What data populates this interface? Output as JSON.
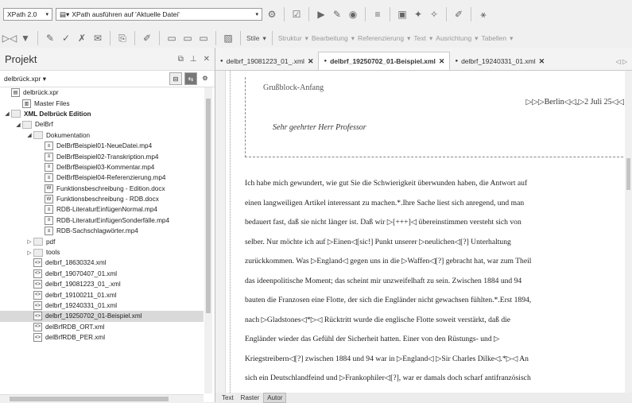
{
  "toolbar": {
    "xpath_version": "XPath 2.0",
    "xpath_scope": "XPath ausführen auf 'Aktuelle Datei'",
    "menus": [
      "Stile",
      "Struktur",
      "Bearbeitung",
      "Referenzierung",
      "Text",
      "Ausrichtung",
      "Tabellen"
    ]
  },
  "project": {
    "title": "Projekt",
    "file": "delbrück.xpr",
    "tree": [
      {
        "label": "delbrück.xpr",
        "depth": 0,
        "twisty": "",
        "icon": "project"
      },
      {
        "label": "Master Files",
        "depth": 1,
        "twisty": "",
        "icon": "master"
      },
      {
        "label": "XML Delbrück Edition",
        "depth": 0,
        "twisty": "◢",
        "icon": "folder",
        "bold": true
      },
      {
        "label": "DelBrf",
        "depth": 1,
        "twisty": "◢",
        "icon": "folder"
      },
      {
        "label": "Dokumentation",
        "depth": 2,
        "twisty": "◢",
        "icon": "folder"
      },
      {
        "label": "DelBrfBeispiel01-NeueDatei.mp4",
        "depth": 3,
        "twisty": "",
        "icon": "file"
      },
      {
        "label": "DelBrfBeispiel02-Transkription.mp4",
        "depth": 3,
        "twisty": "",
        "icon": "file"
      },
      {
        "label": "DelBrfBeispiel03-Kommentar.mp4",
        "depth": 3,
        "twisty": "",
        "icon": "file"
      },
      {
        "label": "DelBrfBeispiel04-Referenzierung.mp4",
        "depth": 3,
        "twisty": "",
        "icon": "file"
      },
      {
        "label": "Funktionsbeschreibung - Edition.docx",
        "depth": 3,
        "twisty": "",
        "icon": "docx"
      },
      {
        "label": "Funktionsbeschreibung - RDB.docx",
        "depth": 3,
        "twisty": "",
        "icon": "docx"
      },
      {
        "label": "RDB-LiteraturEinfügenNormal.mp4",
        "depth": 3,
        "twisty": "",
        "icon": "file"
      },
      {
        "label": "RDB-LiteraturEinfügenSonderfälle.mp4",
        "depth": 3,
        "twisty": "",
        "icon": "file"
      },
      {
        "label": "RDB-Sachschlagwörter.mp4",
        "depth": 3,
        "twisty": "",
        "icon": "file"
      },
      {
        "label": "pdf",
        "depth": 2,
        "twisty": "▷",
        "icon": "folder"
      },
      {
        "label": "tools",
        "depth": 2,
        "twisty": "▷",
        "icon": "folder"
      },
      {
        "label": "delbrf_18630324.xml",
        "depth": 2,
        "twisty": "",
        "icon": "xml"
      },
      {
        "label": "delbrf_19070407_01.xml",
        "depth": 2,
        "twisty": "",
        "icon": "xml"
      },
      {
        "label": "delbrf_19081223_01_.xml",
        "depth": 2,
        "twisty": "",
        "icon": "xml"
      },
      {
        "label": "delbrf_19100211_01.xml",
        "depth": 2,
        "twisty": "",
        "icon": "xml"
      },
      {
        "label": "delbrf_19240331_01.xml",
        "depth": 2,
        "twisty": "",
        "icon": "xml"
      },
      {
        "label": "delbrf_19250702_01-Beispiel.xml",
        "depth": 2,
        "twisty": "",
        "icon": "xml",
        "selected": true
      },
      {
        "label": "delBrfRDB_ORT.xml",
        "depth": 2,
        "twisty": "",
        "icon": "xml"
      },
      {
        "label": "delBrfRDB_PER.xml",
        "depth": 2,
        "twisty": "",
        "icon": "xml"
      }
    ]
  },
  "tabs": [
    {
      "label": "delbrf_19081223_01_.xml",
      "active": false
    },
    {
      "label": "delbrf_19250702_01-Beispiel.xml",
      "active": true
    },
    {
      "label": "delbrf_19240331_01.xml",
      "active": false
    }
  ],
  "editor": {
    "greeting_label": "Grußblock-Anfang",
    "date_line": "▷▷▷Berlin◁◁,▷2 Juli 25◁◁",
    "salutation": "Sehr geehrter Herr Professor",
    "body_lines": [
      "Ich habe mich gewundert, wie gut Sie die Schwierigkeit überwunden haben, die Antwort auf",
      "einen langweiligen Artikel interessant zu machen.*.Ihre Sache liest sich anregend, und man",
      "bedauert fast, daß sie nicht länger ist. Daß wir ▷[+++]◁ übereinstimmen versteht sich von",
      "selber. Nur möchte ich auf ▷Einen◁[sic!] Punkt unserer ▷neulichen◁[?] Unterhaltung",
      "zurückkommen. Was ▷England◁ gegen uns in die ▷Waffen◁[?] gebracht hat, war zum Theil",
      "das ideenpolitische Moment; das scheint mir unzweifelhaft zu sein. Zwischen 1884 und 94",
      "bauten die Franzosen eine Flotte, der sich die Engländer nicht gewachsen fühlten.*.Erst 1894,",
      "nach ▷Gladstones◁*▷◁ Rücktritt wurde die englische Flotte soweit verstärkt, daß die",
      "Engländer wieder das Gefühl der Sicherheit hatten. Einer von den Rüstungs- und ▷",
      "Kriegstreibern◁[?] zwischen 1884 und 94 war in ▷England◁ ▷Sir Charles Dilke◁.*▷◁ An",
      "sich ein Deutschlandfeind und ▷Frankophiler◁[?], war er damals doch scharf antifranzösisch"
    ]
  },
  "bottom_tabs": [
    {
      "label": "Text",
      "active": false
    },
    {
      "label": "Raster",
      "active": false
    },
    {
      "label": "Autor",
      "active": true
    }
  ]
}
